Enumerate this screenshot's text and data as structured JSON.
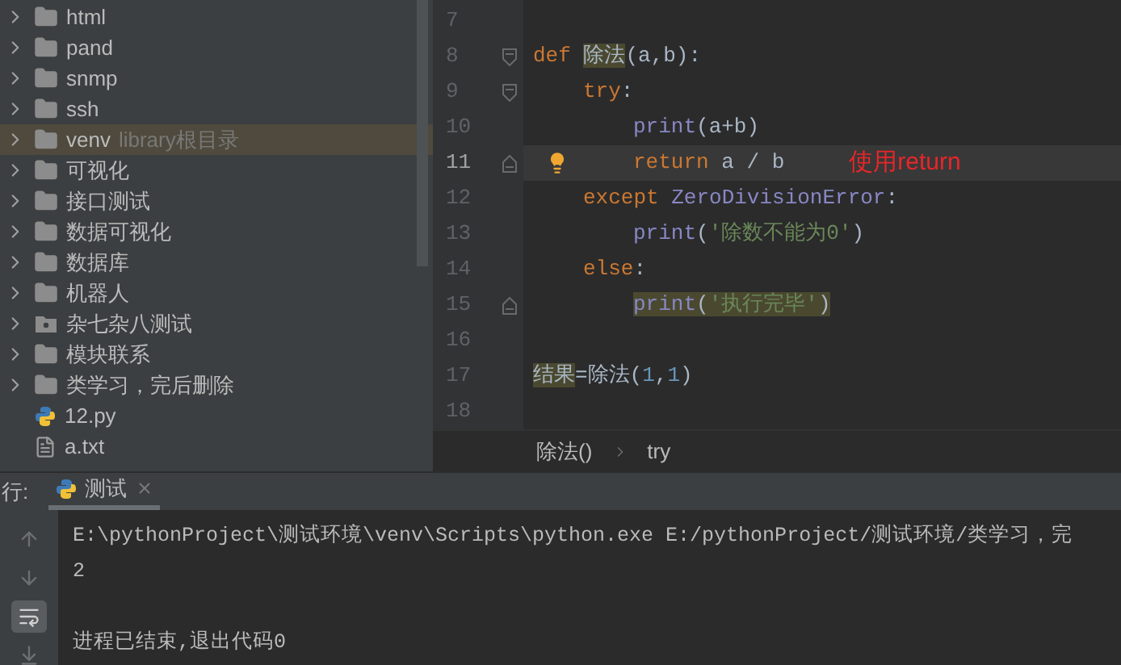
{
  "project_tree": {
    "items": [
      {
        "name": "html",
        "kind": "folder",
        "selected": false
      },
      {
        "name": "pand",
        "kind": "folder",
        "selected": false
      },
      {
        "name": "snmp",
        "kind": "folder",
        "selected": false
      },
      {
        "name": "ssh",
        "kind": "folder",
        "selected": false
      },
      {
        "name": "venv",
        "hint": "library根目录",
        "kind": "folder",
        "selected": true
      },
      {
        "name": "可视化",
        "kind": "folder",
        "selected": false
      },
      {
        "name": "接口测试",
        "kind": "folder",
        "selected": false
      },
      {
        "name": "数据可视化",
        "kind": "folder",
        "selected": false
      },
      {
        "name": "数据库",
        "kind": "folder",
        "selected": false
      },
      {
        "name": "机器人",
        "kind": "folder",
        "selected": false
      },
      {
        "name": "杂七杂八测试",
        "kind": "package",
        "selected": false
      },
      {
        "name": "模块联系",
        "kind": "folder",
        "selected": false
      },
      {
        "name": "类学习，完后删除",
        "kind": "folder",
        "selected": false
      },
      {
        "name": "12.py",
        "kind": "python-file",
        "selected": false
      },
      {
        "name": "a.txt",
        "kind": "text-file",
        "selected": false
      }
    ]
  },
  "editor": {
    "lines": [
      {
        "number": "7",
        "current": false,
        "fold_start": false,
        "fold_end": false,
        "bulb": false
      },
      {
        "number": "8",
        "current": false,
        "fold_start": true,
        "fold_end": false,
        "bulb": false,
        "tokens": [
          {
            "text": "def ",
            "kind": "keyword",
            "highlight": false
          },
          {
            "text": "除法",
            "kind": "plain",
            "highlight": true
          },
          {
            "text": "(a,b):",
            "kind": "plain",
            "highlight": false
          }
        ],
        "children": [
          {
            "number": "9",
            "current": false,
            "fold_start": true,
            "fold_end": false,
            "bulb": false,
            "tokens": [
              {
                "text": "try",
                "kind": "keyword",
                "highlight": false
              },
              {
                "text": ":",
                "kind": "plain",
                "highlight": false
              }
            ],
            "children": [
              {
                "number": "10",
                "current": false,
                "fold_start": false,
                "fold_end": false,
                "bulb": false,
                "tokens": [
                  {
                    "text": "print",
                    "kind": "builtin",
                    "highlight": false
                  },
                  {
                    "text": "(a+b)",
                    "kind": "plain",
                    "highlight": false
                  }
                ]
              },
              {
                "number": "11",
                "current": true,
                "fold_start": false,
                "fold_end": true,
                "bulb": true,
                "note": "使用return",
                "tokens": [
                  {
                    "text": "return ",
                    "kind": "keyword",
                    "highlight": false
                  },
                  {
                    "text": "a / b",
                    "kind": "plain",
                    "highlight": false
                  }
                ]
              }
            ]
          },
          {
            "number": "12",
            "current": false,
            "fold_start": false,
            "fold_end": false,
            "bulb": false,
            "tokens": [
              {
                "text": "except ",
                "kind": "keyword",
                "highlight": false
              },
              {
                "text": "ZeroDivisionError",
                "kind": "builtin",
                "highlight": false
              },
              {
                "text": ":",
                "kind": "plain",
                "highlight": false
              }
            ],
            "children": [
              {
                "number": "13",
                "current": false,
                "fold_start": false,
                "fold_end": false,
                "bulb": false,
                "tokens": [
                  {
                    "text": "print",
                    "kind": "builtin",
                    "highlight": false
                  },
                  {
                    "text": "(",
                    "kind": "plain",
                    "highlight": false
                  },
                  {
                    "text": "'除数不能为0'",
                    "kind": "string",
                    "highlight": false
                  },
                  {
                    "text": ")",
                    "kind": "plain",
                    "highlight": false
                  }
                ]
              }
            ]
          },
          {
            "number": "14",
            "current": false,
            "fold_start": false,
            "fold_end": false,
            "bulb": false,
            "tokens": [
              {
                "text": "else",
                "kind": "keyword",
                "highlight": false
              },
              {
                "text": ":",
                "kind": "plain",
                "highlight": false
              }
            ],
            "children": [
              {
                "number": "15",
                "current": false,
                "fold_start": false,
                "fold_end": true,
                "bulb": false,
                "tokens": [
                  {
                    "text": "print",
                    "kind": "builtin",
                    "highlight": true
                  },
                  {
                    "text": "(",
                    "kind": "plain",
                    "highlight": true
                  },
                  {
                    "text": "'执行完毕'",
                    "kind": "string",
                    "highlight": true
                  },
                  {
                    "text": ")",
                    "kind": "plain",
                    "highlight": true
                  }
                ]
              }
            ]
          }
        ]
      },
      {
        "number": "16",
        "current": false,
        "fold_start": false,
        "fold_end": false,
        "bulb": false
      },
      {
        "number": "17",
        "current": false,
        "fold_start": false,
        "fold_end": false,
        "bulb": false,
        "tokens": [
          {
            "text": "结果",
            "kind": "plain",
            "highlight": true
          },
          {
            "text": "=除法(",
            "kind": "plain",
            "highlight": false
          },
          {
            "text": "1",
            "kind": "number",
            "highlight": false
          },
          {
            "text": ",",
            "kind": "plain",
            "highlight": false
          },
          {
            "text": "1",
            "kind": "number",
            "highlight": false
          },
          {
            "text": ")",
            "kind": "plain",
            "highlight": false
          }
        ]
      },
      {
        "number": "18",
        "current": false,
        "fold_start": false,
        "fold_end": false,
        "bulb": false
      }
    ],
    "breadcrumbs": [
      "除法()",
      "try"
    ]
  },
  "run_panel": {
    "label": "行:",
    "tabs": [
      {
        "label": "测试",
        "selected": true
      }
    ],
    "output": [
      {
        "kind": "text",
        "text": "E:\\pythonProject\\测试环境\\venv\\Scripts\\python.exe E:/pythonProject/测试环境/类学习，完"
      },
      {
        "kind": "text",
        "text": "2"
      },
      {
        "kind": "blank"
      },
      {
        "kind": "text",
        "text": "进程已结束,退出代码0"
      }
    ],
    "tools": [
      {
        "kind": "up",
        "selected": false
      },
      {
        "kind": "down",
        "selected": false
      },
      {
        "kind": "wrap",
        "selected": true
      },
      {
        "kind": "scroll-end",
        "selected": false
      }
    ]
  }
}
